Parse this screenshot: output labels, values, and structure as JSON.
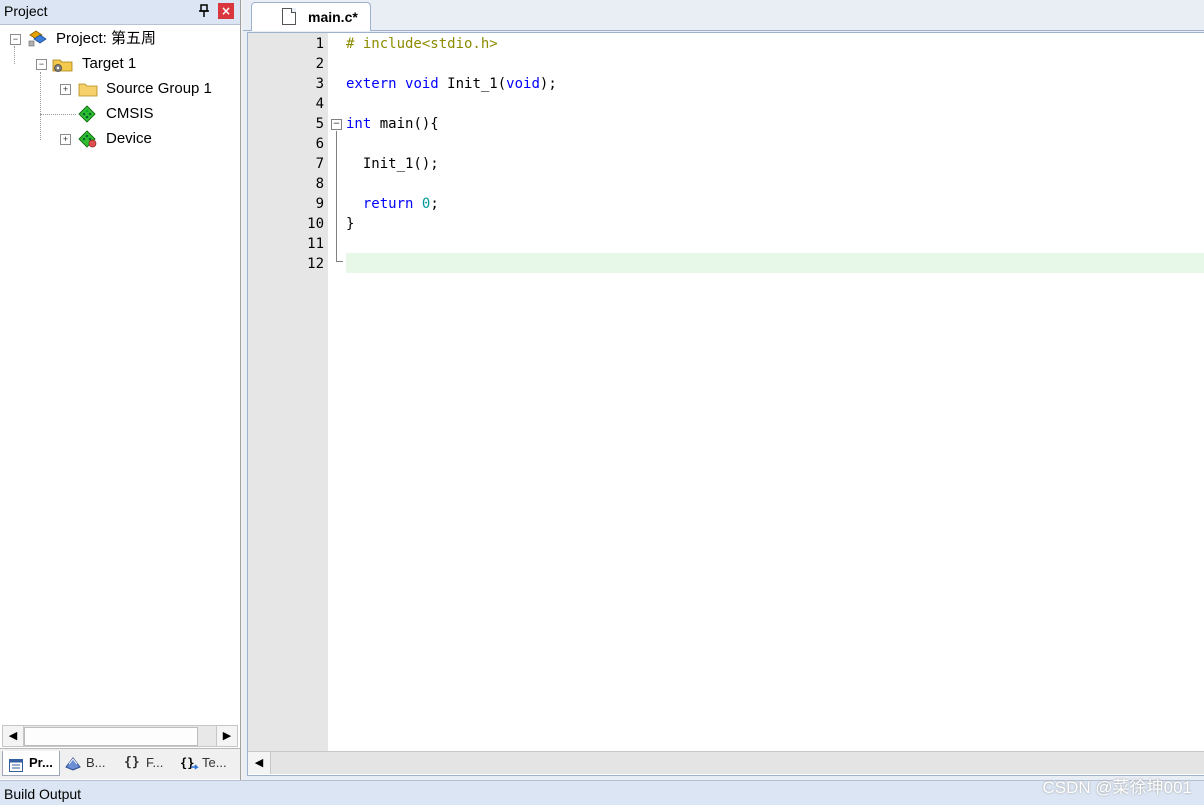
{
  "project_panel": {
    "title": "Project",
    "pin_glyph": "ɪ",
    "close_glyph": "×",
    "tree": {
      "root": "Project: 第五周",
      "target": "Target 1",
      "items": [
        "Source Group 1",
        "CMSIS",
        "Device"
      ]
    },
    "tabs": [
      "Pr...",
      "B...",
      "F...",
      "Te..."
    ]
  },
  "editor": {
    "tab_label": "main.c*",
    "line_numbers": [
      "1",
      "2",
      "3",
      "4",
      "5",
      "6",
      "7",
      "8",
      "9",
      "10",
      "11",
      "12"
    ],
    "code": {
      "l1": "# include<stdio.h>",
      "l3_kw1": "extern",
      "l3_kw2": "void",
      "l3_name": " Init_1(",
      "l3_kw3": "void",
      "l3_end": ");",
      "l5_kw": "int",
      "l5_rest": " main(){",
      "l7": "  Init_1();",
      "l9_kw": "return",
      "l9_num": "0",
      "l9_end": ";",
      "l10": "}"
    },
    "current_line_color": "#e8f8e8"
  },
  "build_output": {
    "title": "Build Output"
  },
  "watermark": "CSDN @菜徐坤001",
  "colors": {
    "keyword": "#0000ff",
    "preprocessor": "#8c8c00",
    "number": "#009999"
  }
}
